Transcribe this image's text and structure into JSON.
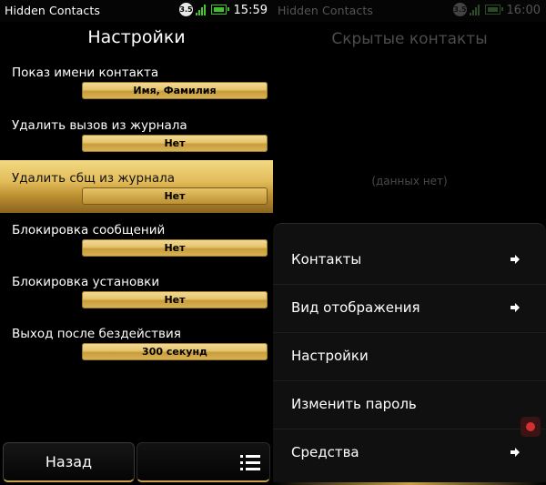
{
  "left_screen": {
    "status_bar": {
      "app_name": "Hidden Contacts",
      "network_badge": "3.5",
      "time": "15:59"
    },
    "title": "Настройки",
    "settings": [
      {
        "label": "Показ имени контакта",
        "value": "Имя, Фамилия"
      },
      {
        "label": "Удалить вызов из журнала",
        "value": "Нет"
      },
      {
        "label": "Удалить сбщ из журнала",
        "value": "Нет"
      },
      {
        "label": "Блокировка сообщений",
        "value": "Нет"
      },
      {
        "label": "Блокировка установки",
        "value": "Нет"
      },
      {
        "label": "Выход после бездействия",
        "value": "300 секунд"
      }
    ],
    "selected_index": 2,
    "back_button": "Назад",
    "menu_icon": "menu-icon"
  },
  "right_screen": {
    "status_bar": {
      "app_name": "Hidden Contacts",
      "network_badge": "3.5",
      "time": "16:00"
    },
    "title": "Скрытые контакты",
    "empty_text": "(данных нет)",
    "menu": [
      {
        "label": "Контакты",
        "has_submenu": true
      },
      {
        "label": "Вид отображения",
        "has_submenu": true
      },
      {
        "label": "Настройки",
        "has_submenu": false
      },
      {
        "label": "Изменить пароль",
        "has_submenu": false
      },
      {
        "label": "Средства",
        "has_submenu": true
      }
    ]
  },
  "colors": {
    "accent_gold": "#e3bc5a",
    "signal_green": "#47c92e",
    "background": "#000000"
  }
}
